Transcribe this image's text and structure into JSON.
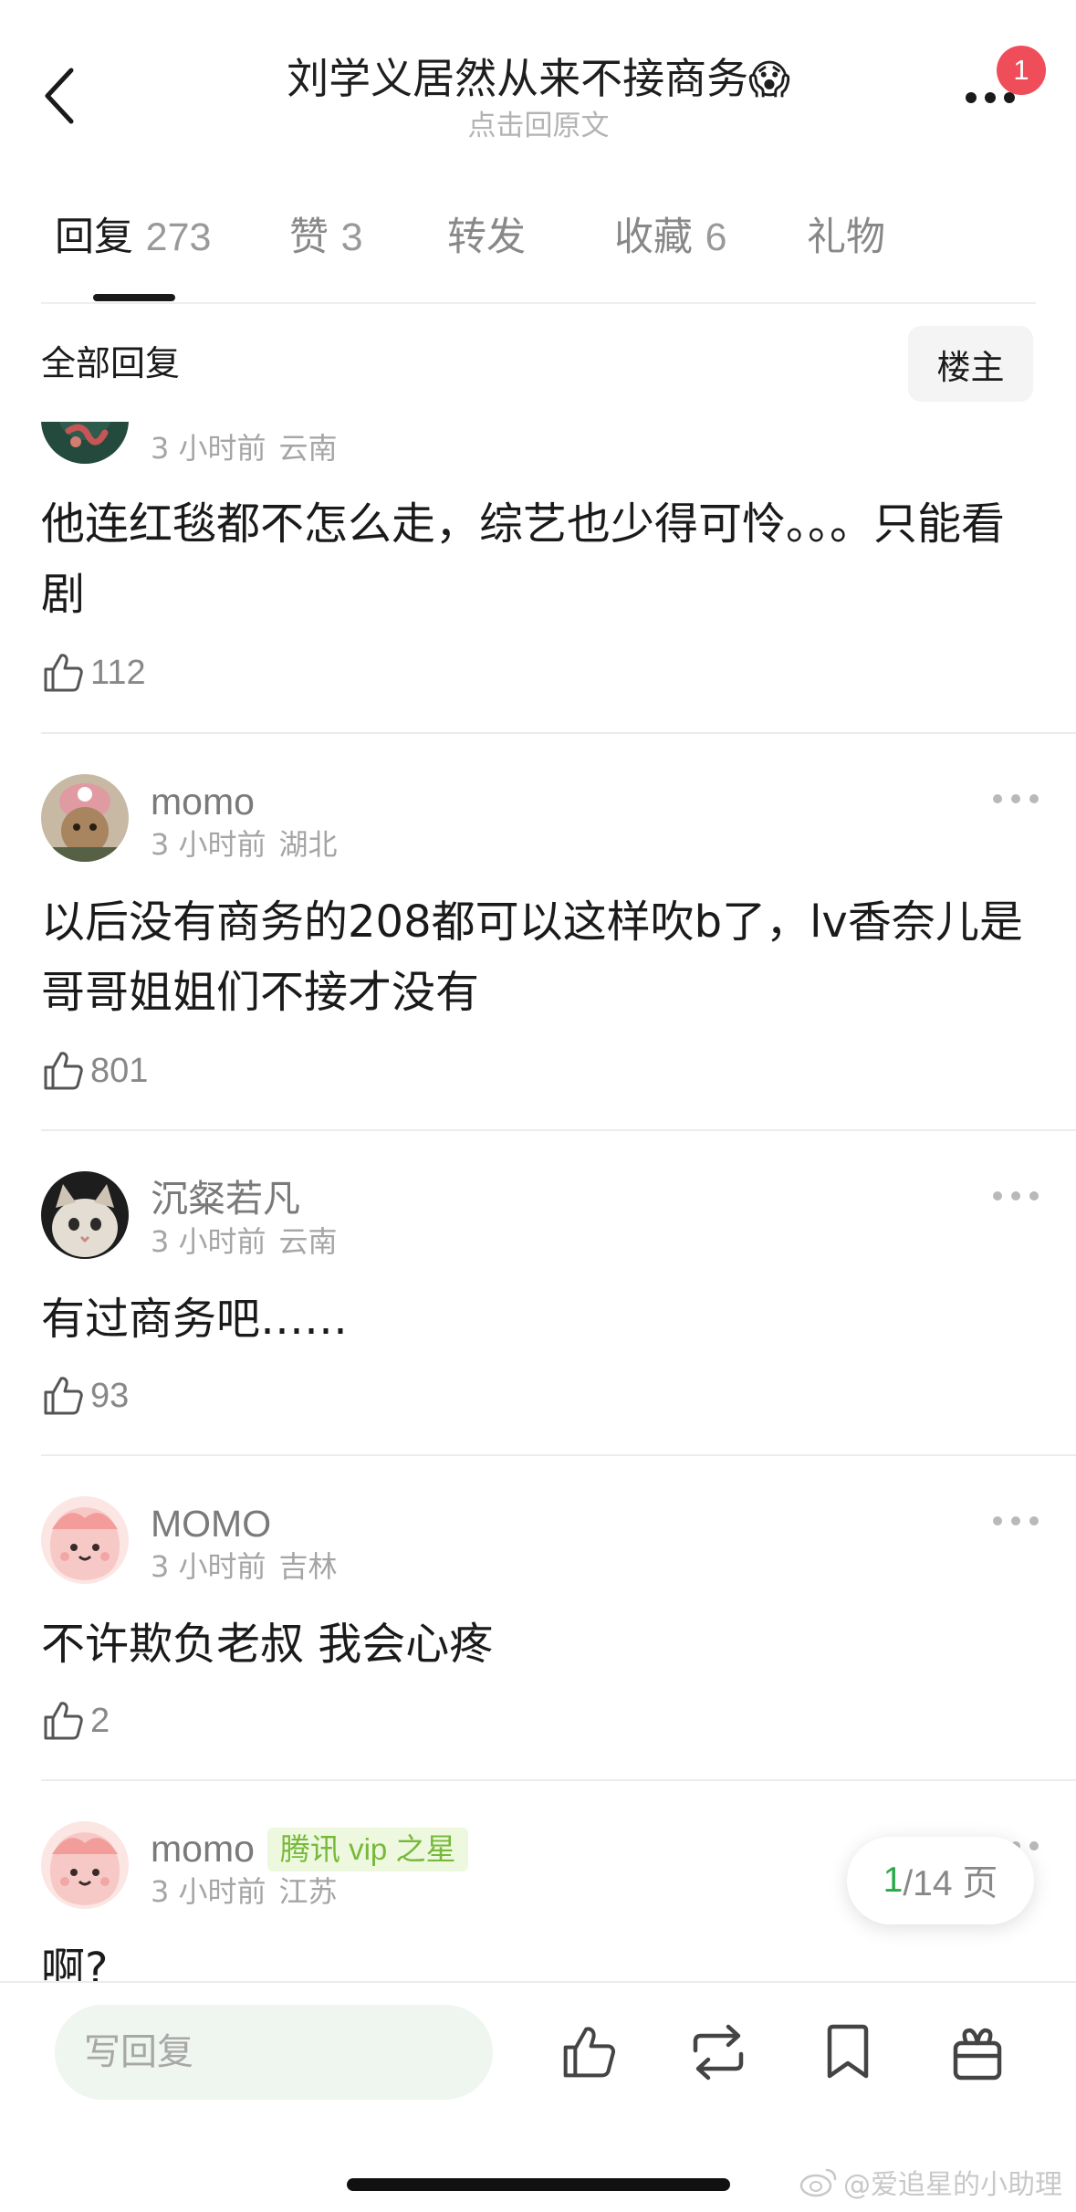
{
  "header": {
    "title": "刘学义居然从来不接商务",
    "title_emoji": "😱",
    "subtitle": "点击回原文",
    "notification_count": "1"
  },
  "tabs": [
    {
      "label": "回复",
      "count": "273",
      "active": true
    },
    {
      "label": "赞",
      "count": "3",
      "active": false
    },
    {
      "label": "转发",
      "count": "",
      "active": false
    },
    {
      "label": "收藏",
      "count": "6",
      "active": false
    },
    {
      "label": "礼物",
      "count": "",
      "active": false
    }
  ],
  "filter": {
    "label": "全部回复",
    "op_button": "楼主"
  },
  "comments": [
    {
      "username": "",
      "time": "3 小时前",
      "location": "云南",
      "text": "他连红毯都不怎么走，综艺也少得可怜。。。只能看剧",
      "likes": "112"
    },
    {
      "username": "momo",
      "time": "3 小时前",
      "location": "湖北",
      "text": "以后没有商务的208都可以这样吹b了，lv香奈儿是哥哥姐姐们不接才没有",
      "likes": "801"
    },
    {
      "username": "沉粲若凡",
      "time": "3 小时前",
      "location": "云南",
      "text": "有过商务吧……",
      "likes": "93"
    },
    {
      "username": "MOMO",
      "time": "3 小时前",
      "location": "吉林",
      "text": "不许欺负老叔 我会心疼",
      "likes": "2"
    },
    {
      "username": "momo",
      "badge": "腾讯 vip 之星",
      "time": "3 小时前",
      "location": "江苏",
      "text": "啊?",
      "likes": ""
    }
  ],
  "pagination": {
    "current": "1",
    "total_text": "/14 页"
  },
  "bottom_bar": {
    "reply_placeholder": "写回复"
  },
  "watermark": "@爱追星的小助理",
  "colors": {
    "accent_green": "#2aa94a",
    "badge_red": "#f04d5a",
    "vip_green": "#77b93a"
  }
}
